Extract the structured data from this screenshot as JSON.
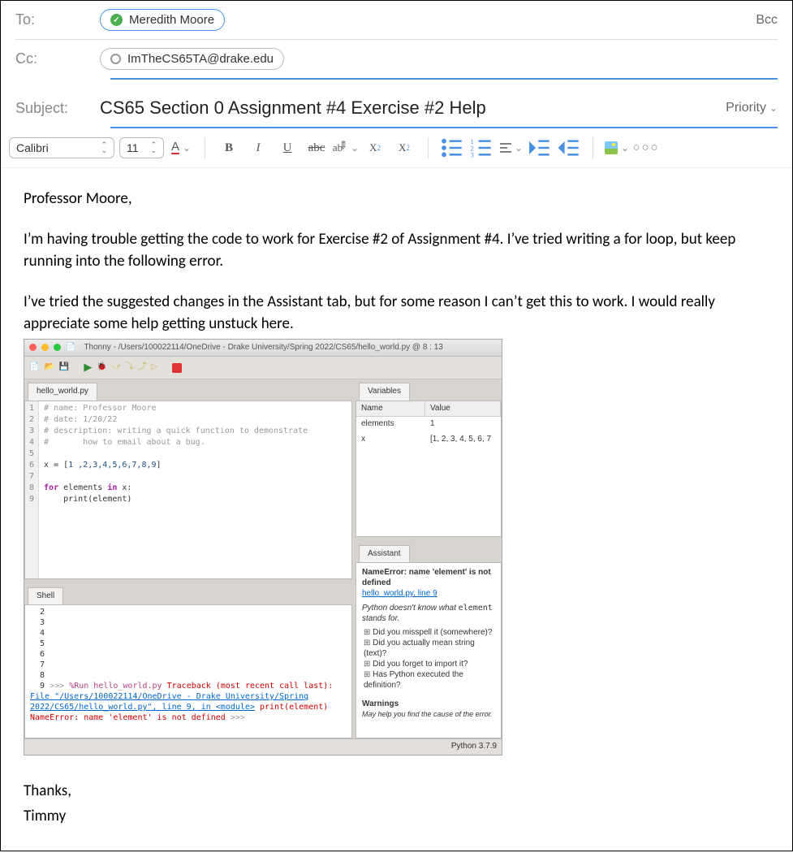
{
  "to": {
    "label": "To:",
    "recipient": "Meredith Moore",
    "bcc": "Bcc"
  },
  "cc": {
    "label": "Cc:",
    "address": "ImTheCS65TA@drake.edu"
  },
  "subject": {
    "label": "Subject:",
    "value": "CS65 Section 0 Assignment #4 Exercise #2 Help",
    "priority": "Priority"
  },
  "toolbar": {
    "font": "Calibri",
    "size": "11",
    "bold": "B",
    "italic": "I",
    "underline": "U",
    "strike": "abc",
    "super": "X",
    "sub": "X"
  },
  "body": {
    "greeting": "Professor Moore,",
    "p1": "I’m having trouble getting the code to work for Exercise #2 of Assignment #4. I’ve tried writing a for loop, but keep running into the following error.",
    "p2": "I’ve tried the suggested changes in the Assistant tab, but for some reason I can’t get this to work. I would really appreciate some help getting unstuck here.",
    "thanks": "Thanks,",
    "sign": "Timmy"
  },
  "thonny": {
    "title": "Thonny  -  /Users/100022114/OneDrive - Drake University/Spring 2022/CS65/hello_world.py  @  8 : 13",
    "file_tab": "hello_world.py",
    "code_lines": [
      "1",
      "2",
      "3",
      "4",
      "5",
      "6",
      "7",
      "8",
      "9"
    ],
    "code": {
      "l1": "# name: Professor Moore",
      "l2": "# date: 1/20/22",
      "l3": "# description: writing a quick function to demonstrate",
      "l4": "#       how to email about a bug.",
      "l6_pre": "x = [",
      "l6_list": "1 ,2,3,4,5,6,7,8,9",
      "l6_post": "]",
      "l8a": "for",
      "l8b": " elements ",
      "l8c": "in",
      "l8d": " x:",
      "l9a": "    print",
      "l9b": "(element)"
    },
    "shell_tab": "Shell",
    "shell": {
      "nums": "  2\n  3\n  4\n  5\n  6\n  7\n  8\n  9",
      "prompt": ">>> ",
      "run": "%Run hello_world.py",
      "tb1": "Traceback (most recent call last):",
      "tb2": "  File \"/Users/100022114/OneDrive - Drake University/Spring 2022/CS65/hello_world.py\", line 9, in <module>",
      "tb3": "    print(element)",
      "tb4": "NameError: name 'element' is not defined"
    },
    "vars_tab": "Variables",
    "vars_h1": "Name",
    "vars_h2": "Value",
    "vars": [
      {
        "n": "elements",
        "v": "1"
      },
      {
        "n": "x",
        "v": "[1, 2, 3, 4, 5, 6, 7"
      }
    ],
    "assist_tab": "Assistant",
    "assist": {
      "err": "NameError: name 'element' is not defined",
      "link": "hello_world.py, line 9",
      "desc1": "Python doesn't know what ",
      "desc_code": "element",
      "desc2": " stands for.",
      "s1": "Did you misspell it (somewhere)?",
      "s2": "Did you actually mean string (text)?",
      "s3": "Did you forget to import it?",
      "s4": "Has Python executed the definition?",
      "warn_h": "Warnings",
      "warn_sub": "May help you find the cause of the error."
    },
    "status": "Python 3.7.9"
  }
}
